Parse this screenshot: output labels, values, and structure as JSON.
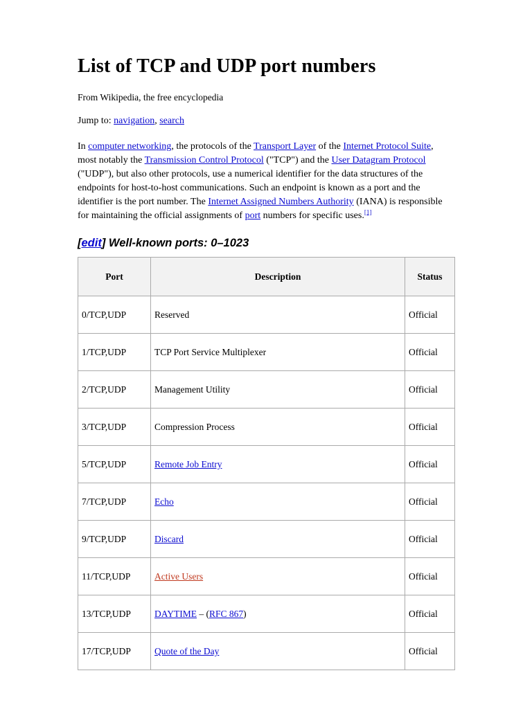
{
  "article": {
    "title": "List of TCP and UDP port numbers",
    "tagline": "From Wikipedia, the free encyclopedia",
    "jump": {
      "label": "Jump to:",
      "navigation": "navigation",
      "separator": ", ",
      "search": "search"
    },
    "intro": {
      "t1": "In ",
      "l1": "computer networking",
      "t2": ", the protocols of the ",
      "l2": "Transport Layer",
      "t3": " of the ",
      "l3": "Internet Protocol Suite",
      "t4": ", most notably the ",
      "l4": "Transmission Control Protocol",
      "t5": " (\"TCP\") and the ",
      "l5": "User Datagram Protocol",
      "t6": " (\"UDP\"), but also other protocols, use a numerical identifier for the data structures of the endpoints for host-to-host communications. Such an endpoint is known as a port and the identifier is the port number. The ",
      "l6": "Internet Assigned Numbers Authority",
      "t7": " (IANA) is responsible for maintaining the official assignments of ",
      "l7": "port",
      "t8": " numbers for specific uses.",
      "citation": "[1]"
    }
  },
  "section": {
    "edit_open": "[",
    "edit_label": "edit",
    "edit_close": "]",
    "heading": " Well-known ports: 0–1023"
  },
  "table": {
    "headers": {
      "port": "Port",
      "description": "Description",
      "status": "Status"
    },
    "rows": [
      {
        "port": "0/TCP,UDP",
        "desc_plain": "Reserved",
        "status": "Official"
      },
      {
        "port": "1/TCP,UDP",
        "desc_plain": "TCP Port Service Multiplexer",
        "status": "Official"
      },
      {
        "port": "2/TCP,UDP",
        "desc_plain": "Management Utility",
        "status": "Official"
      },
      {
        "port": "3/TCP,UDP",
        "desc_plain": "Compression Process",
        "status": "Official"
      },
      {
        "port": "5/TCP,UDP",
        "desc_link": "Remote Job Entry",
        "status": "Official"
      },
      {
        "port": "7/TCP,UDP",
        "desc_link": "Echo",
        "status": "Official"
      },
      {
        "port": "9/TCP,UDP",
        "desc_link": "Discard",
        "status": "Official"
      },
      {
        "port": "11/TCP,UDP",
        "desc_link_red": "Active Users",
        "status": "Official"
      },
      {
        "port": "13/TCP,UDP",
        "desc_link": "DAYTIME",
        "desc_mid": " – (",
        "desc_link2": "RFC 867",
        "desc_tail": ")",
        "status": "Official"
      },
      {
        "port": "17/TCP,UDP",
        "desc_link": "Quote of the Day",
        "status": "Official"
      }
    ]
  },
  "colors": {
    "link_blue": "#0b0bd0",
    "link_red": "#c0391f",
    "header_bg": "#f2f2f2",
    "border": "#aaaaaa"
  }
}
